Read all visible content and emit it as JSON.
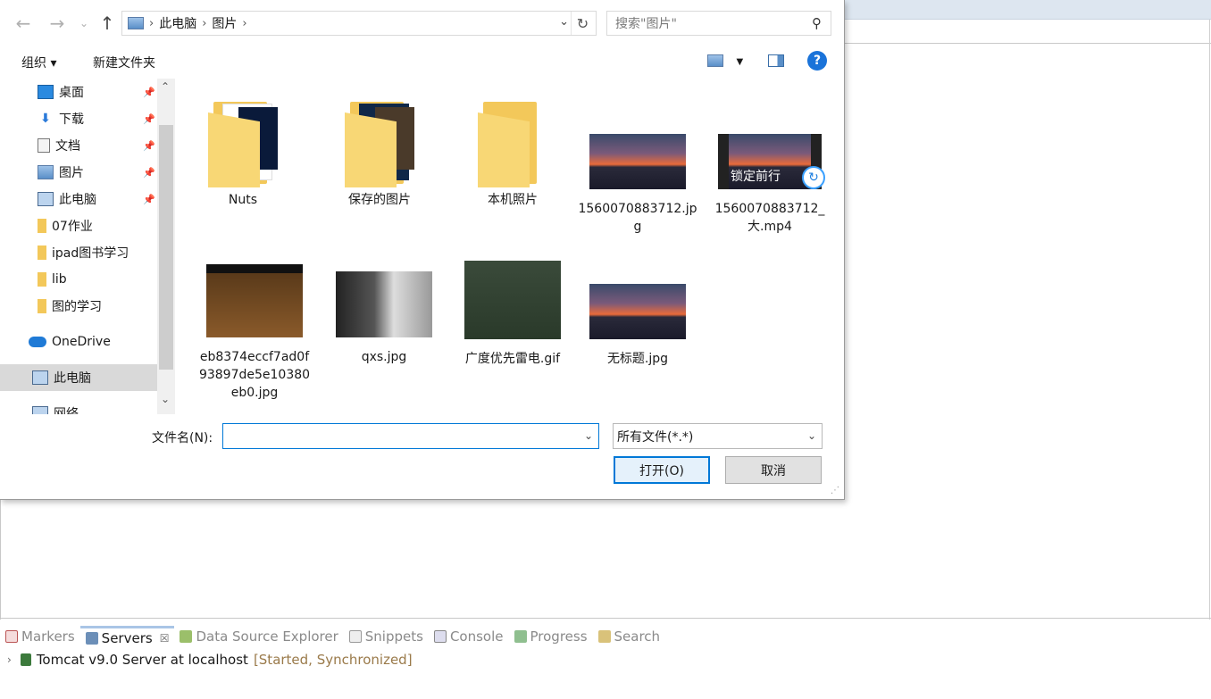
{
  "dialog": {
    "nav": {
      "back": "←",
      "forward": "→",
      "recent": "⌄",
      "up": "↑"
    },
    "address": {
      "root_icon": "pictures-icon",
      "crumbs": [
        "此电脑",
        "图片"
      ]
    },
    "search": {
      "placeholder": "搜索\"图片\""
    },
    "toolbar": {
      "organize": "组织 ▾",
      "new_folder": "新建文件夹",
      "help": "?"
    },
    "sidebar": {
      "items": [
        {
          "label": "桌面",
          "icon": "desktop-icon",
          "pinned": true
        },
        {
          "label": "下载",
          "icon": "download-icon",
          "pinned": true
        },
        {
          "label": "文档",
          "icon": "document-icon",
          "pinned": true
        },
        {
          "label": "图片",
          "icon": "pictures-icon",
          "pinned": true
        },
        {
          "label": "此电脑",
          "icon": "computer-icon",
          "pinned": true
        },
        {
          "label": "07作业",
          "icon": "folder-icon",
          "pinned": false
        },
        {
          "label": "ipad图书学习",
          "icon": "folder-icon",
          "pinned": false
        },
        {
          "label": "lib",
          "icon": "folder-icon",
          "pinned": false
        },
        {
          "label": "图的学习",
          "icon": "folder-icon",
          "pinned": false
        },
        {
          "label": "OneDrive",
          "icon": "cloud-icon",
          "pinned": false
        },
        {
          "label": "此电脑",
          "icon": "computer-icon",
          "pinned": false,
          "selected": true
        },
        {
          "label": "网络",
          "icon": "network-icon",
          "pinned": false
        }
      ]
    },
    "files": [
      {
        "name": "Nuts",
        "kind": "folder"
      },
      {
        "name": "保存的图片",
        "kind": "folder"
      },
      {
        "name": "本机照片",
        "kind": "folder"
      },
      {
        "name": "1560070883712.jpg",
        "kind": "image"
      },
      {
        "name": "1560070883712_大.mp4",
        "kind": "video",
        "caption": "锁定前行"
      },
      {
        "name": "eb8374eccf7ad0f93897de5e10380eb0.jpg",
        "kind": "image"
      },
      {
        "name": "qxs.jpg",
        "kind": "image"
      },
      {
        "name": "广度优先雷电.gif",
        "kind": "image"
      },
      {
        "name": "无标题.jpg",
        "kind": "image"
      }
    ],
    "filename": {
      "label": "文件名(N):",
      "value": ""
    },
    "filter": {
      "value": "所有文件(*.*)"
    },
    "buttons": {
      "open": "打开(O)",
      "cancel": "取消"
    }
  },
  "ide": {
    "views": [
      {
        "label": "Markers",
        "icon": "markers-icon",
        "active": false
      },
      {
        "label": "Servers",
        "icon": "servers-icon",
        "active": true,
        "close": "☒"
      },
      {
        "label": "Data Source Explorer",
        "icon": "datasource-icon",
        "active": false
      },
      {
        "label": "Snippets",
        "icon": "snippets-icon",
        "active": false
      },
      {
        "label": "Console",
        "icon": "console-icon",
        "active": false
      },
      {
        "label": "Progress",
        "icon": "progress-icon",
        "active": false
      },
      {
        "label": "Search",
        "icon": "search-icon",
        "active": false
      }
    ],
    "server": {
      "name": "Tomcat v9.0 Server at localhost",
      "status": "[Started, Synchronized]"
    }
  }
}
